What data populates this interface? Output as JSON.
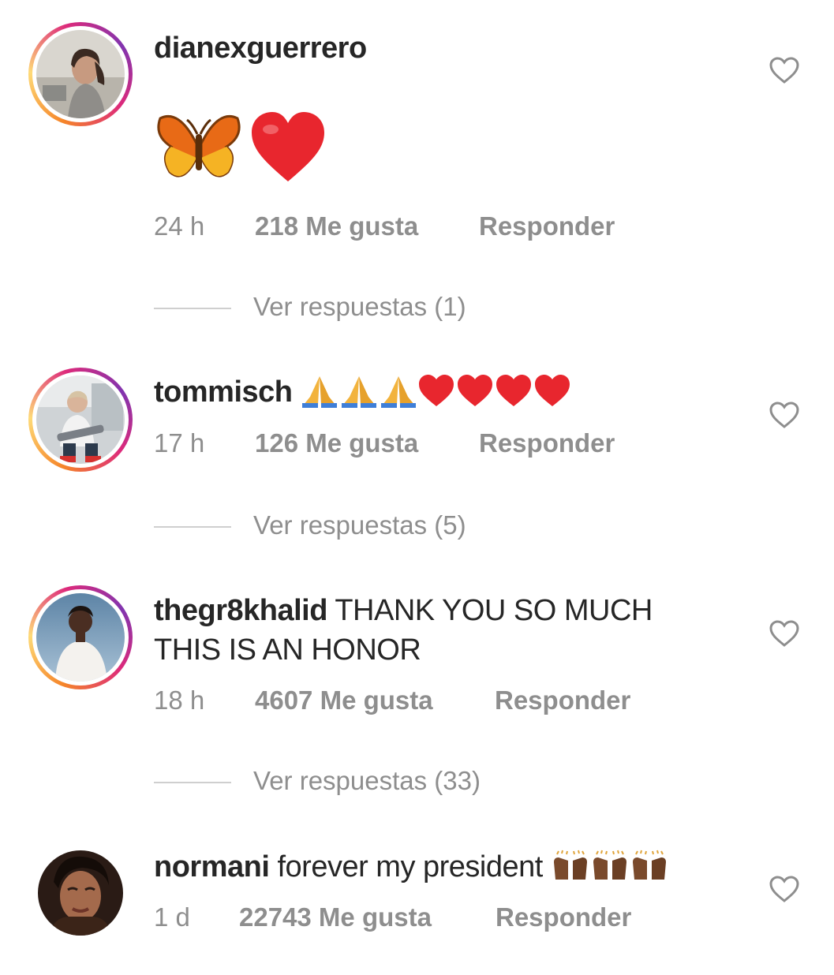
{
  "comments": [
    {
      "username": "dianexguerrero",
      "text": "",
      "emoji": [
        "butterfly",
        "red-heart"
      ],
      "time": "24 h",
      "likes": "218 Me gusta",
      "reply": "Responder",
      "view_replies": "Ver respuestas (1)"
    },
    {
      "username": "tommisch",
      "text": "",
      "emoji": [
        "folded-hands",
        "folded-hands",
        "folded-hands",
        "red-heart",
        "red-heart",
        "red-heart",
        "red-heart"
      ],
      "time": "17 h",
      "likes": "126 Me gusta",
      "reply": "Responder",
      "view_replies": "Ver respuestas (5)"
    },
    {
      "username": "thegr8khalid",
      "text": "THANK YOU SO MUCH",
      "text_line2": "THIS IS AN HONOR",
      "time": "18 h",
      "likes": "4607 Me gusta",
      "reply": "Responder",
      "view_replies": "Ver respuestas (33)"
    },
    {
      "username": "normani",
      "text": "forever my president",
      "emoji": [
        "raising-hands",
        "raising-hands",
        "raising-hands"
      ],
      "time": "1 d",
      "likes": "22743 Me gusta",
      "reply": "Responder"
    }
  ],
  "icons": {
    "like": "heart-outline-icon"
  },
  "colors": {
    "text": "#262626",
    "muted": "#8e8e8e",
    "ring": "#dd2a7b"
  }
}
